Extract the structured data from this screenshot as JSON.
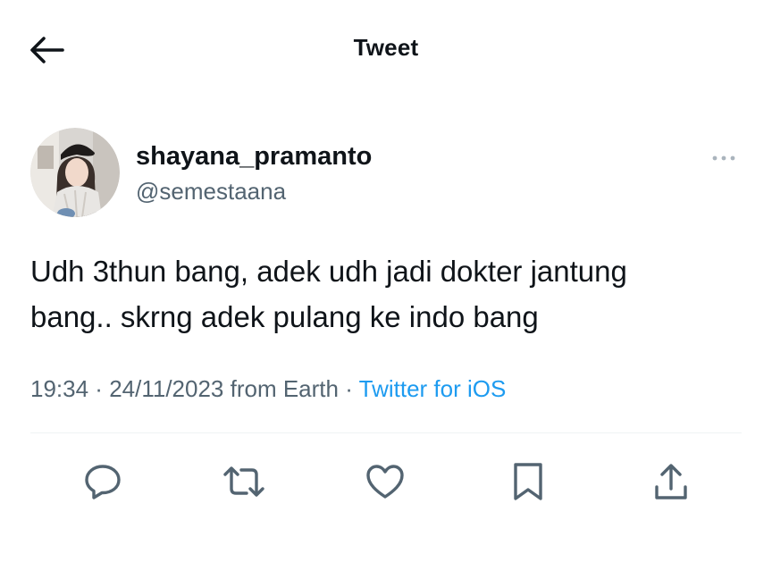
{
  "header": {
    "title": "Tweet",
    "back_icon": "arrow-left-icon"
  },
  "author": {
    "display_name": "shayana_pramanto",
    "handle": "@semestaana",
    "avatar_icon": "avatar-photo",
    "more_icon": "more-horizontal-icon"
  },
  "tweet": {
    "text": "Udh 3thun bang, adek udh jadi dokter jantung\nbang.. skrng adek pulang ke indo bang"
  },
  "meta": {
    "time": "19:34",
    "date_sep": " · ",
    "date": "24/11/2023",
    "location": " from Earth",
    "source_sep": " · ",
    "source": "Twitter for iOS"
  },
  "actions": {
    "icons": [
      "reply-icon",
      "retweet-icon",
      "like-icon",
      "bookmark-icon",
      "share-icon"
    ]
  },
  "colors": {
    "text": "#0f1419",
    "secondary": "#536471",
    "link": "#1d9bf0",
    "divider": "#eff3f4"
  }
}
